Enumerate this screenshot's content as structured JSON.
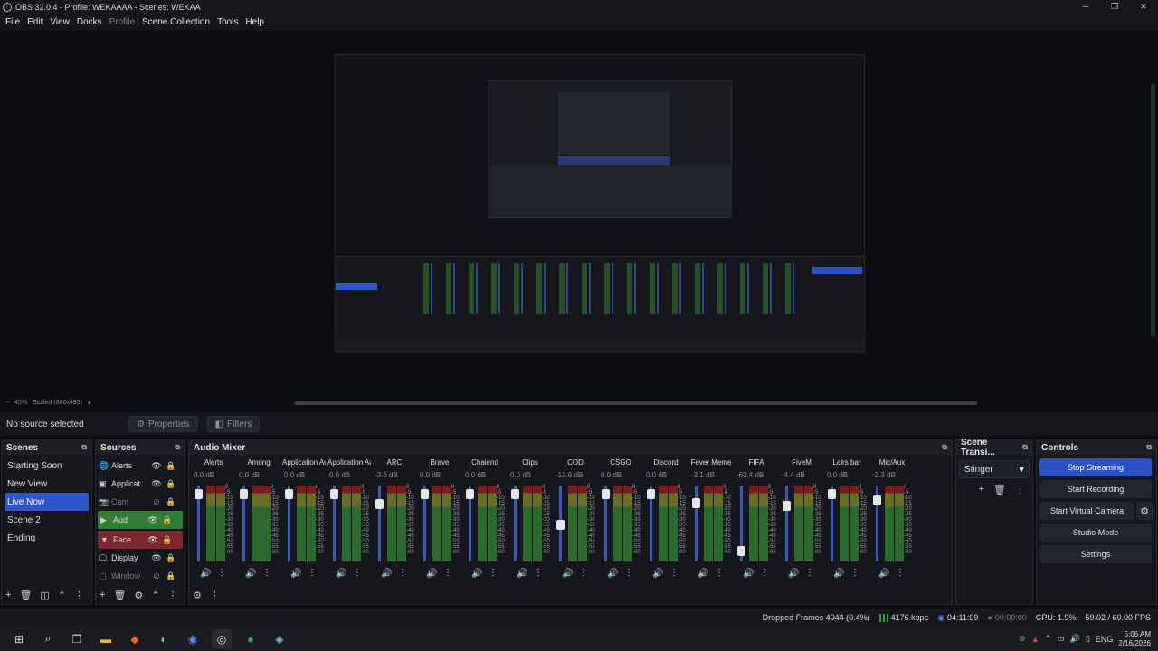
{
  "window": {
    "title": "OBS 32.0.4 - Profile: WEKAAAA - Scenes: WEKAA",
    "minimize": "─",
    "maximize": "❐",
    "close": "✕"
  },
  "menu": [
    "File",
    "Edit",
    "View",
    "Docks",
    "Profile",
    "Scene Collection",
    "Tools",
    "Help"
  ],
  "preview_bar": {
    "zoom_minus": "−",
    "zoom": "45%",
    "scaled": "Scaled (880x495)"
  },
  "context_bar": {
    "no_source": "No source selected",
    "properties": "Properties",
    "filters": "Filters"
  },
  "scenes": {
    "title": "Scenes",
    "items": [
      "Starting Soon",
      "New View",
      "Live Now",
      "Scene 2",
      "Ending"
    ],
    "active": "Live Now"
  },
  "sources": {
    "title": "Sources",
    "items": [
      {
        "name": "Alerts",
        "icon": "browser-icon"
      },
      {
        "name": "Applicat",
        "icon": "window-icon"
      },
      {
        "name": "Cam",
        "icon": "camera-icon"
      },
      {
        "name": "Aud",
        "icon": "folder-icon"
      },
      {
        "name": "Face",
        "icon": "folder-icon"
      },
      {
        "name": "Display",
        "icon": "monitor-icon"
      },
      {
        "name": "Window",
        "icon": "window-icon"
      }
    ]
  },
  "mixer": {
    "title": "Audio Mixer",
    "channels": [
      {
        "name": "Alerts",
        "db": "0.0 dB",
        "level": 0.95
      },
      {
        "name": "Among",
        "db": "0.0 dB",
        "level": 0.95
      },
      {
        "name": "Application Audio C",
        "db": "0.0 dB",
        "level": 0.95
      },
      {
        "name": "Application Audio C",
        "db": "0.0 dB",
        "level": 0.95
      },
      {
        "name": "ARC",
        "db": "-3.6 dB",
        "level": 0.8
      },
      {
        "name": "Brave",
        "db": "0.0 dB",
        "level": 0.95
      },
      {
        "name": "Chaiend",
        "db": "0.0 dB",
        "level": 0.95
      },
      {
        "name": "Clips",
        "db": "0.0 dB",
        "level": 0.95
      },
      {
        "name": "COD",
        "db": "-13.6 dB",
        "level": 0.5
      },
      {
        "name": "CSGO",
        "db": "0.0 dB",
        "level": 0.95
      },
      {
        "name": "Discord",
        "db": "0.0 dB",
        "level": 0.95
      },
      {
        "name": "Fever Meme",
        "db": "-3.1 dB",
        "level": 0.82
      },
      {
        "name": "FIFA",
        "db": "-63.4 dB",
        "level": 0.12
      },
      {
        "name": "FiveM",
        "db": "-4.4 dB",
        "level": 0.78
      },
      {
        "name": "Lairs bar",
        "db": "0.0 dB",
        "level": 0.95
      },
      {
        "name": "Mic/Aux",
        "db": "-2.3 dB",
        "level": 0.85
      }
    ],
    "ticks": "0\n-5\n-10\n-15\n-20\n-25\n-30\n-35\n-40\n-45\n-50\n-55\n-60"
  },
  "transitions": {
    "title": "Scene Transi...",
    "selected": "Stinger"
  },
  "controls": {
    "title": "Controls",
    "stop_streaming": "Stop Streaming",
    "start_recording": "Start Recording",
    "start_virtual_camera": "Start Virtual Camera",
    "studio_mode": "Studio Mode",
    "settings": "Settings"
  },
  "status": {
    "dropped_frames": "Dropped Frames 4044 (0.4%)",
    "bitrate": "4176 kbps",
    "stream_time": "04:11:09",
    "record_time": "00:00:00",
    "cpu": "CPU: 1.9%",
    "fps": "59.02 / 60.00 FPS"
  },
  "taskbar": {
    "lang": "ENG",
    "time": "5:06 AM",
    "date": "2/16/2026"
  },
  "colors": {
    "accent": "#2a52c5",
    "green_group": "#2f7d37",
    "red_group": "#7d2630"
  }
}
